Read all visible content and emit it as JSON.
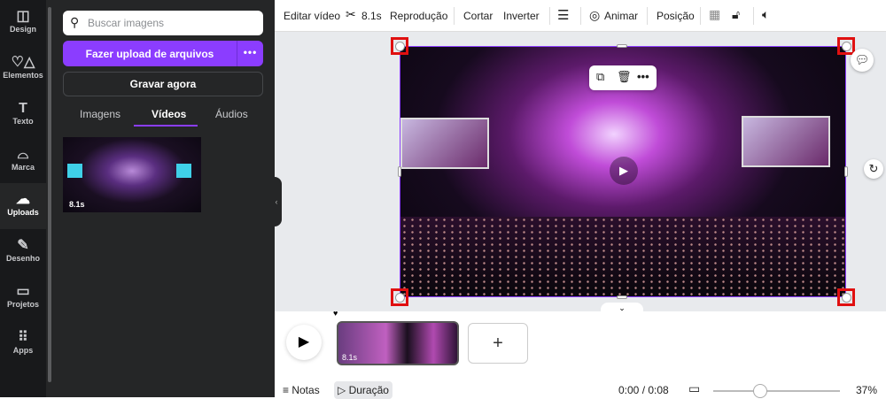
{
  "rail": [
    {
      "label": "Design",
      "icon": "design-icon"
    },
    {
      "label": "Elementos",
      "icon": "elements-icon"
    },
    {
      "label": "Texto",
      "icon": "text-icon"
    },
    {
      "label": "Marca",
      "icon": "brand-icon"
    },
    {
      "label": "Uploads",
      "icon": "upload-cloud-icon",
      "active": true
    },
    {
      "label": "Desenho",
      "icon": "draw-icon"
    },
    {
      "label": "Projetos",
      "icon": "folder-icon"
    },
    {
      "label": "Apps",
      "icon": "apps-icon"
    }
  ],
  "panel": {
    "search_placeholder": "Buscar imagens",
    "upload_label": "Fazer upload de arquivos",
    "more": "•••",
    "record_label": "Gravar agora",
    "tabs": [
      "Imagens",
      "Vídeos",
      "Áudios"
    ],
    "active_tab": "Vídeos",
    "thumb_duration": "8.1s"
  },
  "toolbar": {
    "edit_video": "Editar vídeo",
    "duration": "8.1s",
    "playback": "Reprodução",
    "crop": "Cortar",
    "flip": "Inverter",
    "animate": "Animar",
    "position": "Posição"
  },
  "timeline": {
    "clip_duration": "8.1s",
    "add": "+",
    "notes": "Notas",
    "duration": "Duração",
    "time": "0:00 / 0:08",
    "zoom": "37%",
    "zoom_value": 37
  },
  "colors": {
    "accent": "#8b3dff",
    "rail_bg": "#18191b",
    "panel_bg": "#252627",
    "selection_marker": "#e01010"
  }
}
